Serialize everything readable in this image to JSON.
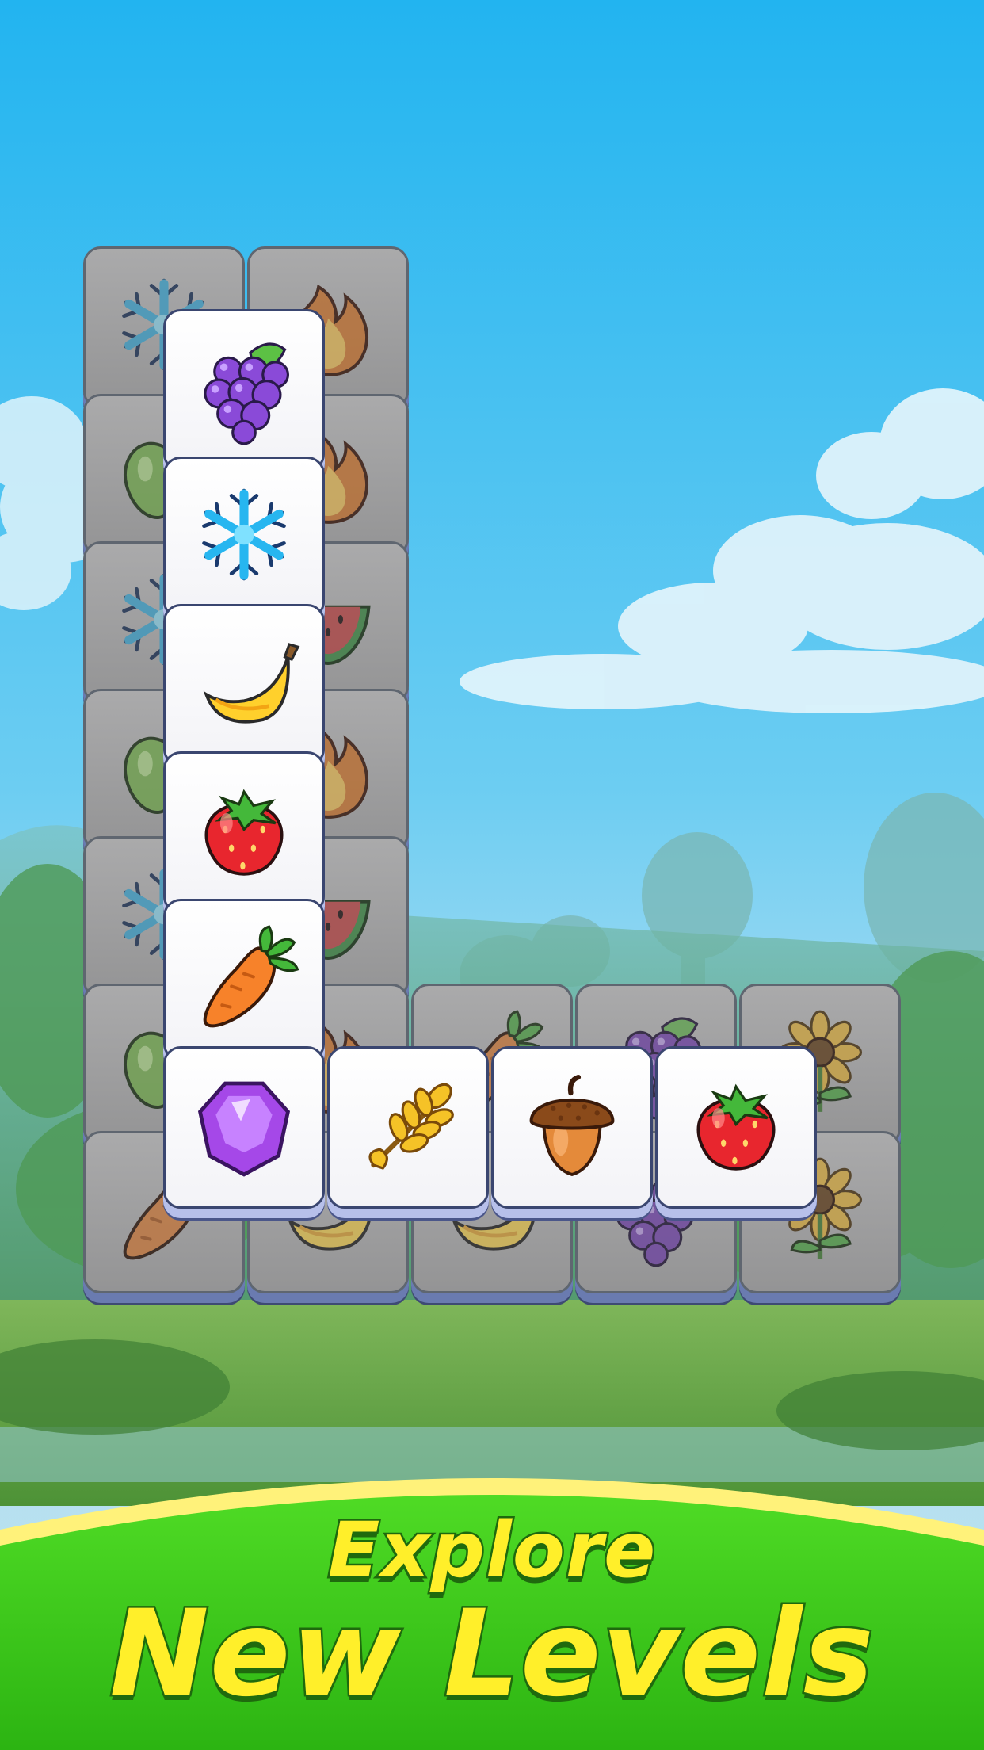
{
  "title": {
    "line1": "Explore",
    "line2": "New Levels"
  },
  "colors": {
    "sky_top": "#22b4f0",
    "sky_bottom": "#a8dcf2",
    "banner_green": "#3ccc1c",
    "banner_rim": "#fff27a",
    "title_fill": "#ffef2a",
    "title_outline": "#1f6a0e"
  },
  "board": {
    "back_layer": [
      {
        "row": 0,
        "col": 0,
        "icon": "snowflake-icon"
      },
      {
        "row": 0,
        "col": 1,
        "icon": "flame-icon"
      },
      {
        "row": 1,
        "col": 0,
        "icon": "apple-icon"
      },
      {
        "row": 1,
        "col": 1,
        "icon": "flame-icon"
      },
      {
        "row": 2,
        "col": 0,
        "icon": "snowflake-icon"
      },
      {
        "row": 2,
        "col": 1,
        "icon": "watermelon-icon"
      },
      {
        "row": 3,
        "col": 0,
        "icon": "apple-icon"
      },
      {
        "row": 3,
        "col": 1,
        "icon": "flame-icon"
      },
      {
        "row": 4,
        "col": 0,
        "icon": "snowflake-icon"
      },
      {
        "row": 4,
        "col": 1,
        "icon": "watermelon-icon"
      },
      {
        "row": 5,
        "col": 0,
        "icon": "apple-icon"
      },
      {
        "row": 5,
        "col": 1,
        "icon": "flame-icon"
      },
      {
        "row": 5,
        "col": 2,
        "icon": "carrot-icon"
      },
      {
        "row": 5,
        "col": 3,
        "icon": "grapes-icon"
      },
      {
        "row": 5,
        "col": 4,
        "icon": "sunflower-icon"
      },
      {
        "row": 6,
        "col": 0,
        "icon": "carrot-icon"
      },
      {
        "row": 6,
        "col": 1,
        "icon": "banana-icon"
      },
      {
        "row": 6,
        "col": 2,
        "icon": "banana-icon"
      },
      {
        "row": 6,
        "col": 3,
        "icon": "grapes-icon"
      },
      {
        "row": 6,
        "col": 4,
        "icon": "sunflower-icon"
      }
    ],
    "front_layer": [
      {
        "row": 0,
        "col": 0,
        "icon": "grapes-icon"
      },
      {
        "row": 1,
        "col": 0,
        "icon": "snowflake-icon"
      },
      {
        "row": 2,
        "col": 0,
        "icon": "banana-icon"
      },
      {
        "row": 3,
        "col": 0,
        "icon": "strawberry-icon"
      },
      {
        "row": 4,
        "col": 0,
        "icon": "carrot-icon"
      },
      {
        "row": 5,
        "col": 0,
        "icon": "gem-icon"
      },
      {
        "row": 5,
        "col": 1,
        "icon": "wheat-icon"
      },
      {
        "row": 5,
        "col": 2,
        "icon": "acorn-icon"
      },
      {
        "row": 5,
        "col": 3,
        "icon": "strawberry-icon"
      }
    ]
  }
}
